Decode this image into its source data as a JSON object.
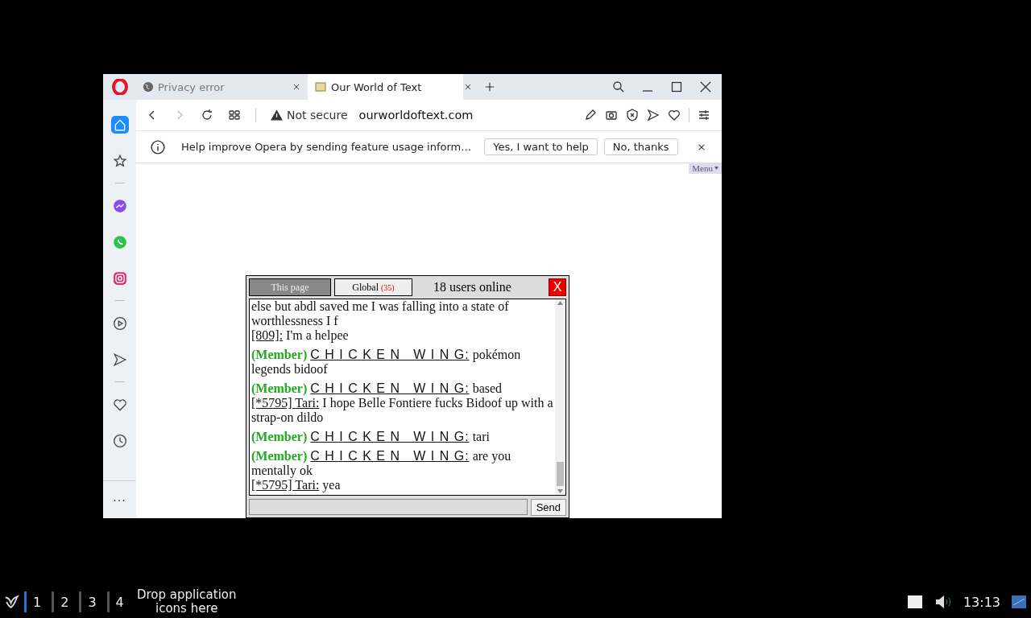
{
  "browser": {
    "tabs": [
      {
        "title": "Privacy error",
        "selected": false
      },
      {
        "title": "Our World of Text",
        "selected": true
      }
    ],
    "address_bar": {
      "security": "Not secure",
      "url": "ourworldoftext.com"
    },
    "sidebar": {
      "items": [
        {
          "kind": "home",
          "selected": true
        },
        {
          "kind": "star",
          "selected": false
        },
        {
          "kind": "divider"
        },
        {
          "kind": "messenger",
          "selected": false
        },
        {
          "kind": "whatsapp",
          "selected": false
        },
        {
          "kind": "instagram",
          "selected": false
        },
        {
          "kind": "divider"
        },
        {
          "kind": "play",
          "selected": false
        },
        {
          "kind": "send",
          "selected": false
        },
        {
          "kind": "divider"
        },
        {
          "kind": "heart",
          "selected": false
        },
        {
          "kind": "clock",
          "selected": false
        }
      ],
      "more": "..."
    },
    "infobar": {
      "message": "Help improve Opera by sending feature usage inform…",
      "buttons": [
        "Yes, I want to help",
        "No, thanks"
      ],
      "close": "×"
    }
  },
  "page": {
    "menu": "Menu",
    "chat": {
      "tabs": [
        {
          "label": "This page",
          "selected": true
        },
        {
          "label": "Global",
          "count": "(35)",
          "selected": false
        }
      ],
      "online": "18 users online",
      "close": "X",
      "messages": [
        {
          "kind": "text",
          "text": "else but abdl saved me I was falling into a state of worthlessness I f"
        },
        {
          "kind": "user",
          "name": "[809]:",
          "text": "I'm a helpee"
        },
        {
          "kind": "member",
          "badge": "(Member)",
          "name": "C H I C K E N   W I N G:",
          "text": "pokémon legends bidoof"
        },
        {
          "kind": "member",
          "badge": "(Member)",
          "name": "C H I C K E N   W I N G:",
          "text": "based"
        },
        {
          "kind": "user",
          "name": "[*5795] Tari:",
          "text": "I hope Belle Fontiere fucks Bidoof up with a strap-on dildo"
        },
        {
          "kind": "member",
          "badge": "(Member)",
          "name": "C H I C K E N   W I N G:",
          "text": "tari"
        },
        {
          "kind": "member",
          "badge": "(Member)",
          "name": "C H I C K E N   W I N G:",
          "text": "are you mentally ok"
        },
        {
          "kind": "user",
          "name": "[*5795] Tari:",
          "text": "yea"
        }
      ],
      "send": "Send"
    }
  },
  "taskbar": {
    "workspaces": [
      {
        "label": "1",
        "selected": true
      },
      {
        "label": "2",
        "selected": false
      },
      {
        "label": "3",
        "selected": false
      },
      {
        "label": "4",
        "selected": false
      }
    ],
    "launcher_hint": "Drop application icons here",
    "clock": "13:13"
  }
}
